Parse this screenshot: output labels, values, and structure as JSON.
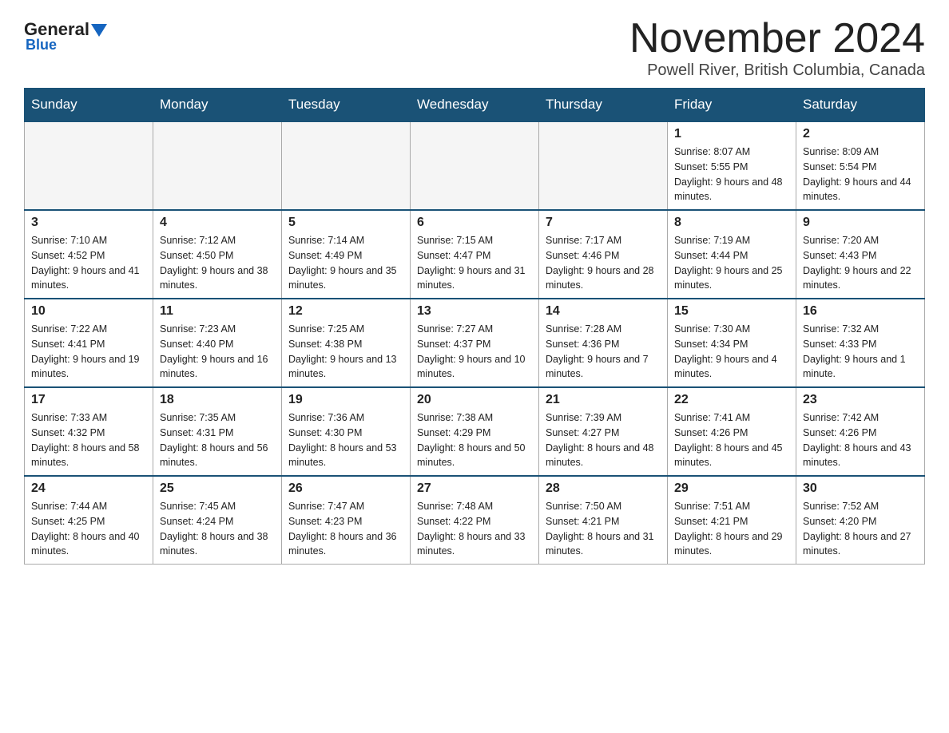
{
  "header": {
    "logo_general": "General",
    "logo_blue": "Blue",
    "month_title": "November 2024",
    "location": "Powell River, British Columbia, Canada"
  },
  "days_of_week": [
    "Sunday",
    "Monday",
    "Tuesday",
    "Wednesday",
    "Thursday",
    "Friday",
    "Saturday"
  ],
  "weeks": [
    [
      {
        "day": "",
        "empty": true
      },
      {
        "day": "",
        "empty": true
      },
      {
        "day": "",
        "empty": true
      },
      {
        "day": "",
        "empty": true
      },
      {
        "day": "",
        "empty": true
      },
      {
        "day": "1",
        "sunrise": "Sunrise: 8:07 AM",
        "sunset": "Sunset: 5:55 PM",
        "daylight": "Daylight: 9 hours and 48 minutes."
      },
      {
        "day": "2",
        "sunrise": "Sunrise: 8:09 AM",
        "sunset": "Sunset: 5:54 PM",
        "daylight": "Daylight: 9 hours and 44 minutes."
      }
    ],
    [
      {
        "day": "3",
        "sunrise": "Sunrise: 7:10 AM",
        "sunset": "Sunset: 4:52 PM",
        "daylight": "Daylight: 9 hours and 41 minutes."
      },
      {
        "day": "4",
        "sunrise": "Sunrise: 7:12 AM",
        "sunset": "Sunset: 4:50 PM",
        "daylight": "Daylight: 9 hours and 38 minutes."
      },
      {
        "day": "5",
        "sunrise": "Sunrise: 7:14 AM",
        "sunset": "Sunset: 4:49 PM",
        "daylight": "Daylight: 9 hours and 35 minutes."
      },
      {
        "day": "6",
        "sunrise": "Sunrise: 7:15 AM",
        "sunset": "Sunset: 4:47 PM",
        "daylight": "Daylight: 9 hours and 31 minutes."
      },
      {
        "day": "7",
        "sunrise": "Sunrise: 7:17 AM",
        "sunset": "Sunset: 4:46 PM",
        "daylight": "Daylight: 9 hours and 28 minutes."
      },
      {
        "day": "8",
        "sunrise": "Sunrise: 7:19 AM",
        "sunset": "Sunset: 4:44 PM",
        "daylight": "Daylight: 9 hours and 25 minutes."
      },
      {
        "day": "9",
        "sunrise": "Sunrise: 7:20 AM",
        "sunset": "Sunset: 4:43 PM",
        "daylight": "Daylight: 9 hours and 22 minutes."
      }
    ],
    [
      {
        "day": "10",
        "sunrise": "Sunrise: 7:22 AM",
        "sunset": "Sunset: 4:41 PM",
        "daylight": "Daylight: 9 hours and 19 minutes."
      },
      {
        "day": "11",
        "sunrise": "Sunrise: 7:23 AM",
        "sunset": "Sunset: 4:40 PM",
        "daylight": "Daylight: 9 hours and 16 minutes."
      },
      {
        "day": "12",
        "sunrise": "Sunrise: 7:25 AM",
        "sunset": "Sunset: 4:38 PM",
        "daylight": "Daylight: 9 hours and 13 minutes."
      },
      {
        "day": "13",
        "sunrise": "Sunrise: 7:27 AM",
        "sunset": "Sunset: 4:37 PM",
        "daylight": "Daylight: 9 hours and 10 minutes."
      },
      {
        "day": "14",
        "sunrise": "Sunrise: 7:28 AM",
        "sunset": "Sunset: 4:36 PM",
        "daylight": "Daylight: 9 hours and 7 minutes."
      },
      {
        "day": "15",
        "sunrise": "Sunrise: 7:30 AM",
        "sunset": "Sunset: 4:34 PM",
        "daylight": "Daylight: 9 hours and 4 minutes."
      },
      {
        "day": "16",
        "sunrise": "Sunrise: 7:32 AM",
        "sunset": "Sunset: 4:33 PM",
        "daylight": "Daylight: 9 hours and 1 minute."
      }
    ],
    [
      {
        "day": "17",
        "sunrise": "Sunrise: 7:33 AM",
        "sunset": "Sunset: 4:32 PM",
        "daylight": "Daylight: 8 hours and 58 minutes."
      },
      {
        "day": "18",
        "sunrise": "Sunrise: 7:35 AM",
        "sunset": "Sunset: 4:31 PM",
        "daylight": "Daylight: 8 hours and 56 minutes."
      },
      {
        "day": "19",
        "sunrise": "Sunrise: 7:36 AM",
        "sunset": "Sunset: 4:30 PM",
        "daylight": "Daylight: 8 hours and 53 minutes."
      },
      {
        "day": "20",
        "sunrise": "Sunrise: 7:38 AM",
        "sunset": "Sunset: 4:29 PM",
        "daylight": "Daylight: 8 hours and 50 minutes."
      },
      {
        "day": "21",
        "sunrise": "Sunrise: 7:39 AM",
        "sunset": "Sunset: 4:27 PM",
        "daylight": "Daylight: 8 hours and 48 minutes."
      },
      {
        "day": "22",
        "sunrise": "Sunrise: 7:41 AM",
        "sunset": "Sunset: 4:26 PM",
        "daylight": "Daylight: 8 hours and 45 minutes."
      },
      {
        "day": "23",
        "sunrise": "Sunrise: 7:42 AM",
        "sunset": "Sunset: 4:26 PM",
        "daylight": "Daylight: 8 hours and 43 minutes."
      }
    ],
    [
      {
        "day": "24",
        "sunrise": "Sunrise: 7:44 AM",
        "sunset": "Sunset: 4:25 PM",
        "daylight": "Daylight: 8 hours and 40 minutes."
      },
      {
        "day": "25",
        "sunrise": "Sunrise: 7:45 AM",
        "sunset": "Sunset: 4:24 PM",
        "daylight": "Daylight: 8 hours and 38 minutes."
      },
      {
        "day": "26",
        "sunrise": "Sunrise: 7:47 AM",
        "sunset": "Sunset: 4:23 PM",
        "daylight": "Daylight: 8 hours and 36 minutes."
      },
      {
        "day": "27",
        "sunrise": "Sunrise: 7:48 AM",
        "sunset": "Sunset: 4:22 PM",
        "daylight": "Daylight: 8 hours and 33 minutes."
      },
      {
        "day": "28",
        "sunrise": "Sunrise: 7:50 AM",
        "sunset": "Sunset: 4:21 PM",
        "daylight": "Daylight: 8 hours and 31 minutes."
      },
      {
        "day": "29",
        "sunrise": "Sunrise: 7:51 AM",
        "sunset": "Sunset: 4:21 PM",
        "daylight": "Daylight: 8 hours and 29 minutes."
      },
      {
        "day": "30",
        "sunrise": "Sunrise: 7:52 AM",
        "sunset": "Sunset: 4:20 PM",
        "daylight": "Daylight: 8 hours and 27 minutes."
      }
    ]
  ]
}
